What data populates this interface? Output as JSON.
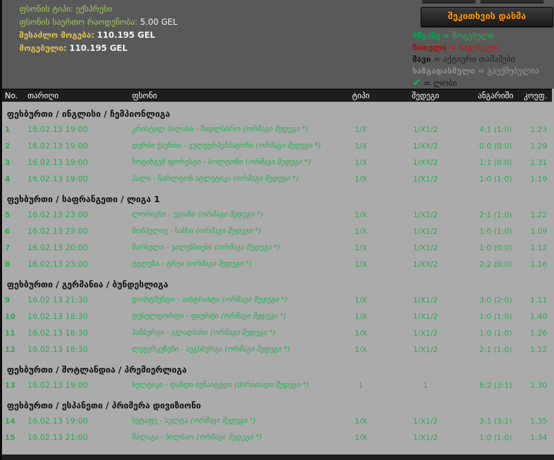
{
  "summary": {
    "bet_type_label": "ფსონის ტიპი:",
    "bet_type_value": "ექსპრესი",
    "total_label": "ფსონის საერთო რაოდენობა:",
    "total_value": "5.00 GEL",
    "possible_win_label": "შესაძლო მოგება:",
    "possible_win_value": "110.195 GEL",
    "won_label": "მოგებული:",
    "won_value": "110.195 GEL"
  },
  "ask_button": {
    "label": "შეკითხვის დასმა"
  },
  "legend": [
    {
      "key": "green",
      "term": "მწვანე",
      "equals": " = ",
      "desc": "მოგებული"
    },
    {
      "key": "red",
      "term": "წითელი",
      "equals": " = ",
      "desc": "წაგებული"
    },
    {
      "key": "black",
      "term": "შავი",
      "equals": " = ",
      "desc": "აქტიური თამაშები"
    },
    {
      "key": "gray",
      "term": "ხაზგადასმული",
      "equals": " = ",
      "desc": "გაუქმებულია"
    },
    {
      "key": "check",
      "term": "✔",
      "equals": " = ",
      "desc": "ლობი"
    }
  ],
  "table": {
    "headers": {
      "no": "No.",
      "date": "თარიღი",
      "bet": "ფსონი",
      "type": "ტიპი",
      "result": "შედეგი",
      "score": "ანგარიში",
      "coef": "კოეფ."
    },
    "sections": [
      {
        "title": "ფეხბურთი / ინგლისი / ჩემპიონლიგა",
        "rows": [
          {
            "no": "1",
            "date": "16.02.13 19:00",
            "match": "კრისტალ პალასი - მიდლსბრო",
            "note": "(ორმაგი შედეგი *)",
            "type": "1/X",
            "result": "1/X1/2",
            "score": "4:1 (1:0)",
            "coef": "1.23"
          },
          {
            "no": "2",
            "date": "16.02.13 19:00",
            "match": "დერბი ქაუნთი - ვულვერჰემპატონი",
            "note": "(ორმაგი შედეგი *)",
            "type": "1/X",
            "result": "1/XX/2",
            "score": "0:0 (0:0)",
            "coef": "1.29"
          },
          {
            "no": "3",
            "date": "16.02.13 19:00",
            "match": "ნოტინგემ ფორესტი - ბოლტონი",
            "note": "(ორმაგი შედეგი *)",
            "type": "1/X",
            "result": "1/XX/2",
            "score": "1:1 (0:0)",
            "coef": "1.31"
          },
          {
            "no": "4",
            "date": "16.02.13 19:00",
            "match": "ჰალი - ჩარლტონ ატლეტიკი",
            "note": "(ორმაგი შედეგი *)",
            "type": "1/X",
            "result": "1/X1/2",
            "score": "1:0 (1:0)",
            "coef": "1.19"
          }
        ]
      },
      {
        "title": "ფეხბურთი / საფრანგეთი / ლიგა 1",
        "rows": [
          {
            "no": "5",
            "date": "16.02.13 23:00",
            "match": "ლორიენი - ევიანი",
            "note": "(ორმაგი შედეგი *)",
            "type": "1/X",
            "result": "1/X1/2",
            "score": "2:1 (1:0)",
            "coef": "1.22"
          },
          {
            "no": "6",
            "date": "16.02.13 23:00",
            "match": "მონპელიე - ნანსი",
            "note": "(ორმაგი შედეგი *)",
            "type": "1/X",
            "result": "1/X1/2",
            "score": "1:0 (1:0)",
            "coef": "1.09"
          },
          {
            "no": "7",
            "date": "16.02.13 20:00",
            "match": "მარსელი - ვალენსიენი",
            "note": "(ორმაგი შედეგი *)",
            "type": "1/X",
            "result": "1/X1/2",
            "score": "1:0 (0:0)",
            "coef": "1.12"
          },
          {
            "no": "8",
            "date": "16.02.13 23:00",
            "match": "ტულუზა - ტრუა",
            "note": "(ორმაგი შედეგი *)",
            "type": "1/X",
            "result": "1/XX/2",
            "score": "2:2 (0:0)",
            "coef": "1.16"
          }
        ]
      },
      {
        "title": "ფეხბურთი / გერმანია / ბუნდესლიგა",
        "rows": [
          {
            "no": "9",
            "date": "16.02.13 21:30",
            "match": "დორტმუნდი - აინტრახტი",
            "note": "(ორმაგი შედეგი *)",
            "type": "1/X",
            "result": "1/X1/2",
            "score": "3:0 (2:0)",
            "coef": "1.11"
          },
          {
            "no": "10",
            "date": "16.02.13 18:30",
            "match": "დუსელდორფი - ფიურტი",
            "note": "(ორმაგი შედეგი *)",
            "type": "1/X",
            "result": "1/X1/2",
            "score": "1:0 (1:0)",
            "coef": "1.40"
          },
          {
            "no": "11",
            "date": "16.02.13 18:30",
            "match": "ჰამბურგი - გლადბახი",
            "note": "(ორმაგი შედეგი *)",
            "type": "1/X",
            "result": "1/X1/2",
            "score": "1:0 (1:0)",
            "coef": "1.26"
          },
          {
            "no": "12",
            "date": "16.02.13 18:30",
            "match": "ლევერკუზენი - აუგსბურგი",
            "note": "(ორმაგი შედეგი *)",
            "type": "1/X",
            "result": "1/X1/2",
            "score": "2:1 (1:0)",
            "coef": "1.12"
          }
        ]
      },
      {
        "title": "ფეხბურთი / შოტლანდია / პრემიერლიგა",
        "rows": [
          {
            "no": "13",
            "date": "16.02.13 19:00",
            "match": "სელტიკი - დანდი იუნაიტედი",
            "note": "(ძირითადი შედეგი *)",
            "type": "1",
            "result": "1",
            "score": "6:2 (3:1)",
            "coef": "1.30"
          }
        ]
      },
      {
        "title": "ფეხბურთი / ესპანეთი / პრიმერა დივიზიონი",
        "rows": [
          {
            "no": "14",
            "date": "16.02.13 19:00",
            "match": "ხეტაფე - სელტა",
            "note": "(ორმაგი შედეგი *)",
            "type": "1/X",
            "result": "1/X1/2",
            "score": "3:1 (3:1)",
            "coef": "1.35"
          },
          {
            "no": "15",
            "date": "16.02.13 21:00",
            "match": "მალაგა - ბილბაო",
            "note": "(ორმაგი შედეგი *)",
            "type": "1/X",
            "result": "1/X1/2",
            "score": "1:0 (1:0)",
            "coef": "1.34"
          }
        ]
      }
    ]
  },
  "colors": {
    "won_green": "#2aab55",
    "lost_red": "#c31414",
    "cancelled_gray": "#989898",
    "accent_orange": "#ff9900",
    "panel_gray": "#595959",
    "page_bg": "#ababab",
    "header_bar": "#1e1e1e"
  }
}
